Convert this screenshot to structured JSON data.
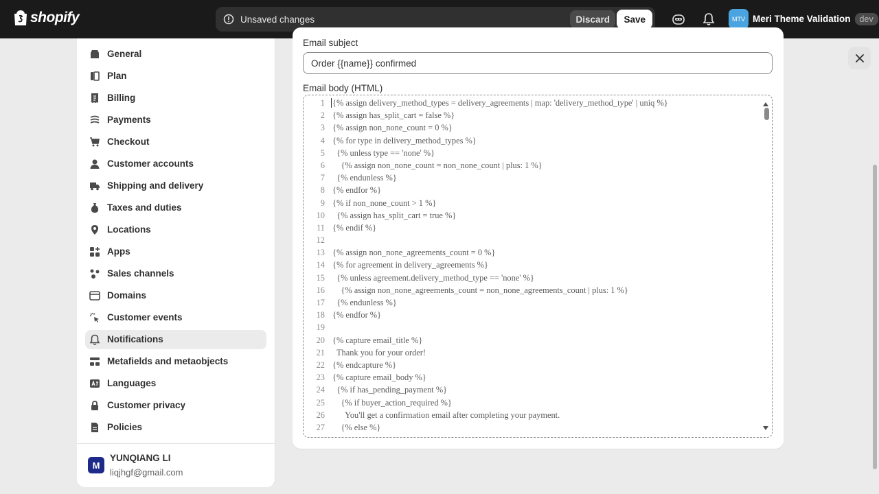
{
  "topbar": {
    "logo_text": "shopify",
    "unsaved_text": "Unsaved changes",
    "discard_label": "Discard",
    "save_label": "Save",
    "store_initials": "MTV",
    "store_name": "Meri Theme Validation",
    "store_badge": "dev"
  },
  "sidebar": {
    "items": [
      {
        "label": "General",
        "icon": "store-icon"
      },
      {
        "label": "Plan",
        "icon": "plan-icon"
      },
      {
        "label": "Billing",
        "icon": "receipt-icon"
      },
      {
        "label": "Payments",
        "icon": "payments-icon"
      },
      {
        "label": "Checkout",
        "icon": "cart-icon"
      },
      {
        "label": "Customer accounts",
        "icon": "person-icon"
      },
      {
        "label": "Shipping and delivery",
        "icon": "truck-icon"
      },
      {
        "label": "Taxes and duties",
        "icon": "money-bag-icon"
      },
      {
        "label": "Locations",
        "icon": "location-pin-icon"
      },
      {
        "label": "Apps",
        "icon": "apps-icon"
      },
      {
        "label": "Sales channels",
        "icon": "channels-icon"
      },
      {
        "label": "Domains",
        "icon": "globe-icon"
      },
      {
        "label": "Customer events",
        "icon": "cursor-click-icon"
      },
      {
        "label": "Notifications",
        "icon": "bell-icon",
        "active": true
      },
      {
        "label": "Metafields and metaobjects",
        "icon": "metafields-icon"
      },
      {
        "label": "Languages",
        "icon": "language-icon"
      },
      {
        "label": "Customer privacy",
        "icon": "lock-icon"
      },
      {
        "label": "Policies",
        "icon": "document-icon"
      }
    ],
    "user": {
      "initial": "M",
      "name": "YUNQIANG LI",
      "email": "liqjhgf@gmail.com"
    }
  },
  "main": {
    "subject_label": "Email subject",
    "subject_value": "Order {{name}} confirmed",
    "body_label": "Email body (HTML)",
    "code_lines": [
      "{% assign delivery_method_types = delivery_agreements | map: 'delivery_method_type' | uniq %}",
      "{% assign has_split_cart = false %}",
      "{% assign non_none_count = 0 %}",
      "{% for type in delivery_method_types %}",
      "  {% unless type == 'none' %}",
      "    {% assign non_none_count = non_none_count | plus: 1 %}",
      "  {% endunless %}",
      "{% endfor %}",
      "{% if non_none_count > 1 %}",
      "  {% assign has_split_cart = true %}",
      "{% endif %}",
      "",
      "{% assign non_none_agreements_count = 0 %}",
      "{% for agreement in delivery_agreements %}",
      "  {% unless agreement.delivery_method_type == 'none' %}",
      "    {% assign non_none_agreements_count = non_none_agreements_count | plus: 1 %}",
      "  {% endunless %}",
      "{% endfor %}",
      "",
      "{% capture email_title %}",
      "  Thank you for your order!",
      "{% endcapture %}",
      "{% capture email_body %}",
      "  {% if has_pending_payment %}",
      "    {% if buyer_action_required %}",
      "      You'll get a confirmation email after completing your payment.",
      "    {% else %}"
    ]
  }
}
